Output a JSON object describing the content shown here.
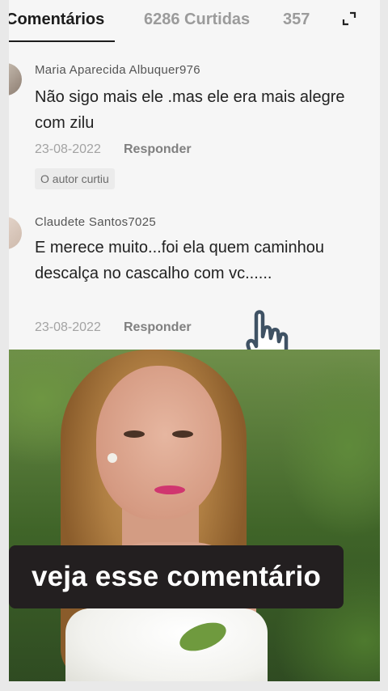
{
  "tabs": {
    "comments_label": "Comentários",
    "likes_label": "6286 Curtidas",
    "count_label": "357"
  },
  "comments": [
    {
      "author": "Maria Aparecida Albuquer976",
      "text": "Não sigo mais ele .mas ele era mais alegre com zilu",
      "date": "23-08-2022",
      "reply_label": "Responder",
      "badge": "O autor curtiu"
    },
    {
      "author": "Claudete Santos7025",
      "text": "E merece muito...foi ela quem caminhou descalça no cascalho com vc......",
      "date": "23-08-2022",
      "reply_label": "Responder"
    }
  ],
  "video": {
    "caption": "veja esse comentário"
  },
  "icons": {
    "expand": "expand-icon",
    "hand": "hand-pointer-icon"
  },
  "colors": {
    "caption_bg": "#231f20",
    "lips": "#d0366f",
    "active_tab": "#1c1c1c"
  }
}
